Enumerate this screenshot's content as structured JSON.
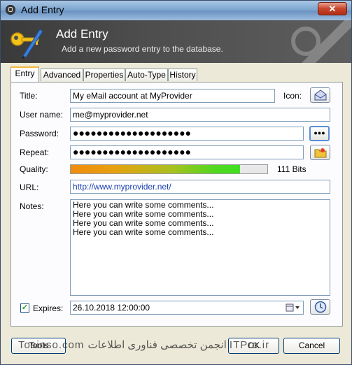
{
  "window": {
    "title": "Add Entry",
    "close_label": "✕"
  },
  "banner": {
    "title": "Add Entry",
    "subtitle": "Add a new password entry to the database."
  },
  "tabs": [
    "Entry",
    "Advanced",
    "Properties",
    "Auto-Type",
    "History"
  ],
  "form": {
    "title_label": "Title:",
    "title_value": "My eMail account at MyProvider",
    "icon_label": "Icon:",
    "username_label": "User name:",
    "username_value": "me@myprovider.net",
    "password_label": "Password:",
    "password_value": "●●●●●●●●●●●●●●●●●●●●",
    "reveal_label": "●●●",
    "repeat_label": "Repeat:",
    "repeat_value": "●●●●●●●●●●●●●●●●●●●●",
    "quality_label": "Quality:",
    "quality_fraction": 0.86,
    "quality_text": "111 Bits",
    "url_label": "URL:",
    "url_value": "http://www.myprovider.net/",
    "notes_label": "Notes:",
    "notes_lines": [
      "Here you can write some comments...",
      "Here you can write some comments...",
      "Here you can write some comments...",
      "Here you can write some comments..."
    ],
    "expires_checked": true,
    "expires_label": "Expires:",
    "expires_value": "26.10.2018 12:00:00"
  },
  "buttons": {
    "tools": "Tools",
    "ok": "OK",
    "cancel": "Cancel"
  },
  "watermark": "Tosinso.com  انجمن تخصصی فناوری اطلاعات ITPro.ir"
}
